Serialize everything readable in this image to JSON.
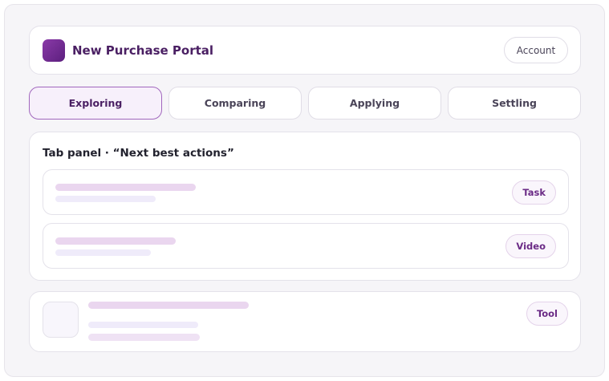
{
  "header": {
    "title": "New Purchase Portal",
    "account_label": "Account"
  },
  "tabs": [
    {
      "label": "Exploring",
      "active": true
    },
    {
      "label": "Comparing",
      "active": false
    },
    {
      "label": "Applying",
      "active": false
    },
    {
      "label": "Settling",
      "active": false
    }
  ],
  "panel": {
    "title": "Tab panel · “Next best actions”",
    "items": [
      {
        "badge": "Task"
      },
      {
        "badge": "Video"
      }
    ]
  },
  "bottom_card": {
    "badge": "Tool"
  },
  "colors": {
    "accent": "#6b2b86",
    "brand_dark": "#4a1f63",
    "skeleton_primary": "#ead6ef",
    "skeleton_secondary": "#efebfa"
  }
}
